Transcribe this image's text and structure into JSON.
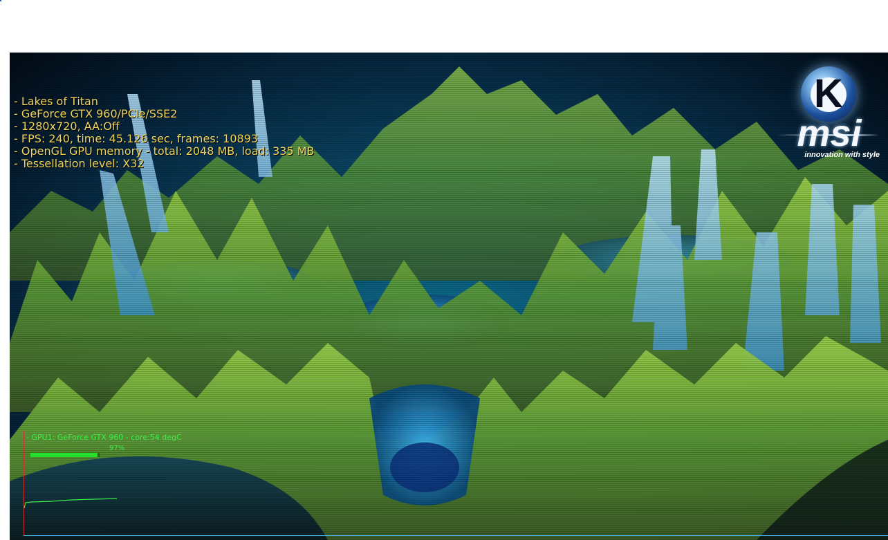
{
  "app": {
    "info_lines": [
      "- Lakes of Titan",
      "- GeForce GTX 960/PCIe/SSE2",
      "- 1280x720, AA:Off",
      "- FPS: 240, time: 45.126 sec, frames: 10893",
      "- OpenGL GPU memory - total: 2048 MB, load: 335 MB",
      "- Tessellation level: X32"
    ]
  },
  "logo": {
    "letter": "K",
    "brand": "msi",
    "tagline": "innovation with style"
  },
  "gpu_monitor": {
    "label": "- GPU1: GeForce GTX 960 - core:54 degC",
    "usage_text": "97%",
    "usage_fraction": 0.97,
    "line_color": "#3cf04a"
  },
  "colors": {
    "info_text": "#f0d45a",
    "monitor_text": "#3cf04a",
    "terrain_green": "#6fae3a",
    "terrain_ice": "#7ec8ec",
    "water": "#1a7fb8"
  }
}
